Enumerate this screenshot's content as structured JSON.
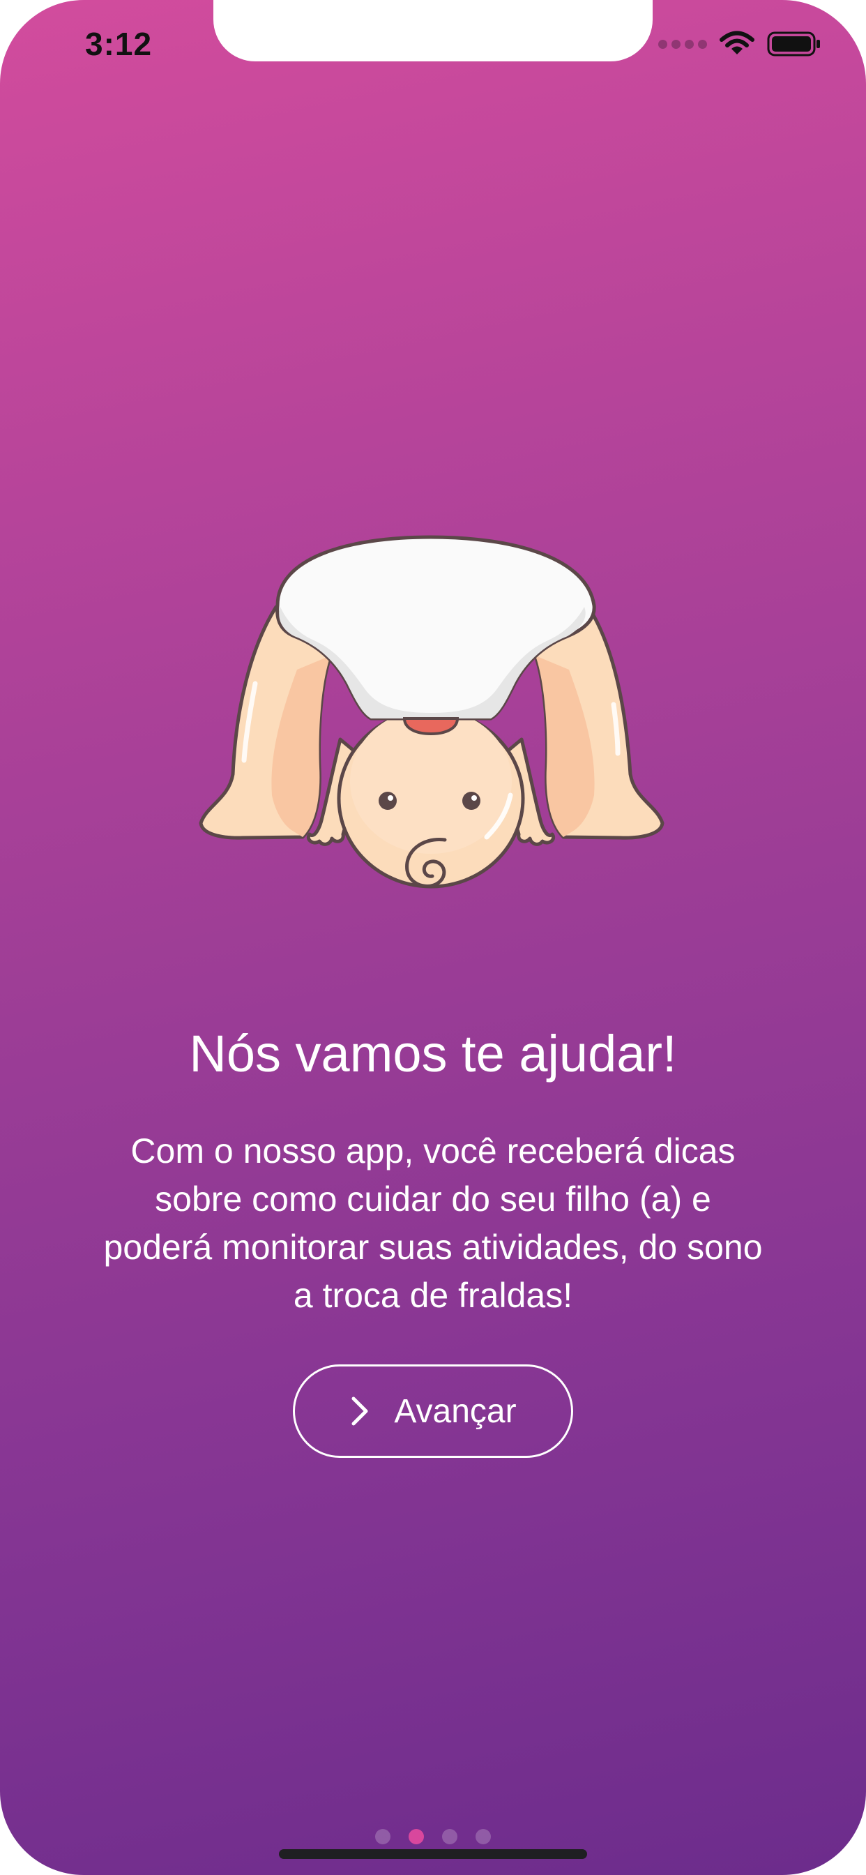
{
  "status_bar": {
    "time": "3:12"
  },
  "onboarding": {
    "title": "Nós vamos te ajudar!",
    "description": "Com o nosso app, você receberá dicas sobre como cuidar do seu filho (a) e poderá monitorar suas atividades, do sono a troca de fraldas!",
    "advance_label": "Avançar",
    "page_indicator": {
      "pages": 4,
      "current": 2
    }
  },
  "colors": {
    "gradient_top": "#d24c9d",
    "gradient_bottom": "#6c2c8c",
    "active_dot": "#d9479d",
    "text": "#ffffff"
  },
  "icons": {
    "advance": "chevron-right-icon",
    "wifi": "wifi-icon",
    "battery": "battery-icon",
    "signal": "cellular-signal-icon"
  }
}
